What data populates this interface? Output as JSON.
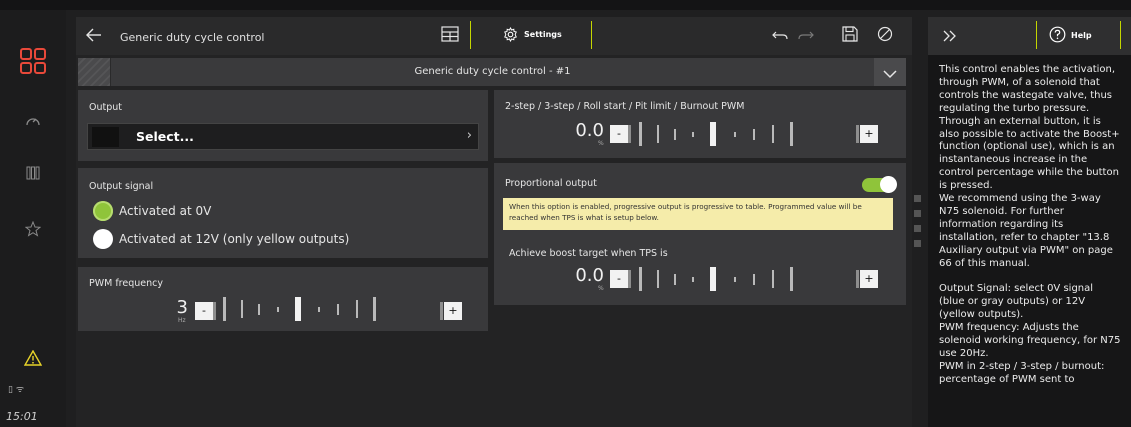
{
  "sidebar": {
    "status_icons": "▯ ᯤ",
    "clock": "15:01"
  },
  "header": {
    "title": "Generic duty cycle control",
    "settings_label": "Settings"
  },
  "instance": {
    "label": "Generic duty cycle control - #1"
  },
  "output": {
    "title": "Output",
    "select_text": "Select...",
    "chevron": "›"
  },
  "output_signal": {
    "title": "Output signal",
    "options": [
      {
        "label": "Activated at 0V",
        "color": "#8fc43a",
        "selected": true
      },
      {
        "label": "Activated at 12V (only yellow outputs)",
        "color": "#ffffff",
        "selected": false
      }
    ]
  },
  "pwm_frequency": {
    "title": "PWM frequency",
    "value": "3",
    "unit": "Hz"
  },
  "step_pwm": {
    "title": "2-step / 3-step / Roll start / Pit limit / Burnout PWM",
    "value": "0.0",
    "unit": "%"
  },
  "proportional": {
    "title": "Proportional output",
    "enabled": true,
    "notice": "When this option is enabled, progressive output is progressive to table. Programmed value will be reached when TPS is what is setup below.",
    "boost_title": "Achieve boost target when TPS is",
    "value": "0.0",
    "unit": "%"
  },
  "stepper": {
    "minus": "-",
    "plus": "+"
  },
  "help": {
    "tab_label": "Help",
    "paragraphs": [
      "This control enables the activation, through PWM, of a solenoid that controls the wastegate valve, thus regulating the turbo pressure. Through an external button, it is also possible to activate the Boost+ function (optional use), which is an instantaneous increase in the control percentage while the button is pressed.",
      "We recommend using the 3-way N75 solenoid. For further information regarding its installation, refer to chapter \"13.8 Auxiliary output via PWM\" on page 66 of this manual.",
      "",
      "Output Signal: select 0V signal (blue or gray outputs) or 12V (yellow outputs).",
      "PWM frequency: Adjusts the solenoid working frequency, for N75 use 20Hz.",
      "PWM in 2-step / 3-step / burnout: percentage of PWM sent to"
    ]
  },
  "colors": {
    "accent": "#c4d600",
    "warning": "#e8d42a",
    "logo": "#e8493a",
    "toggle_on": "#8fc43a"
  }
}
